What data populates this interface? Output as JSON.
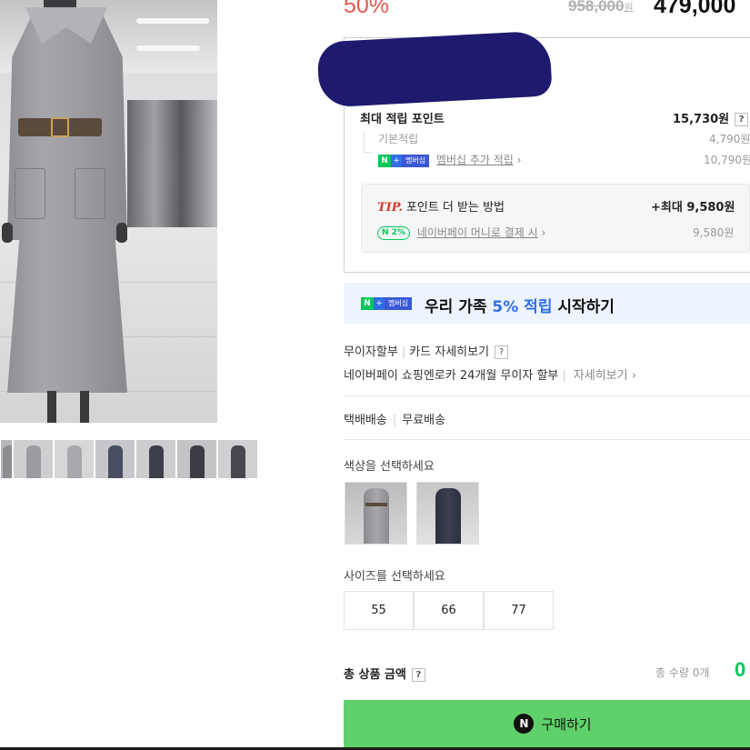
{
  "price": {
    "discount_rate": "50%",
    "original": "958,000",
    "original_unit": "원",
    "sale": "479,000"
  },
  "points": {
    "max_label": "최대 적립 포인트",
    "max_value": "15,730원",
    "help": "?",
    "basic_label": "기본적립",
    "basic_value": "4,790원",
    "membership_badge": {
      "n": "N",
      "plus": "+",
      "text": "멤버십"
    },
    "membership_label": "멤버십 추가 적립",
    "membership_arrow": "›",
    "membership_value": "10,790원"
  },
  "tip": {
    "tip_word": "TIP.",
    "title": "포인트 더 받는 방법",
    "value": "+최대 9,580원",
    "pay_badge": "N 2%",
    "pay_label": "네이버페이 머니로 결제 시",
    "pay_arrow": "›",
    "pay_value": "9,580원"
  },
  "promo": {
    "prefix": "우리 가족 ",
    "highlight": "5% 적립",
    "suffix": " 시작하기"
  },
  "installment": {
    "label": "무이자할부",
    "card_link": "카드 자세히보기",
    "help": "?",
    "detail": "네이버페이 쇼핑엔로카 24개월 무이자 할부",
    "detail_link": "자세히보기",
    "detail_arrow": "›"
  },
  "shipping": {
    "method": "택배배송",
    "fee": "무료배송"
  },
  "options": {
    "color_label": "색상을 선택하세요",
    "size_label": "사이즈를 선택하세요",
    "sizes": [
      "55",
      "66",
      "77"
    ]
  },
  "total": {
    "label": "총 상품 금액",
    "help": "?",
    "quantity": "총 수량 0개",
    "amount": "0"
  },
  "buy_button": {
    "icon": "N",
    "label": "구매하기"
  },
  "colors": {
    "brand_green": "#03c75a",
    "button_green": "#5fd16a",
    "discount_red": "#e05a4c",
    "membership_blue": "#2f6ee8"
  }
}
